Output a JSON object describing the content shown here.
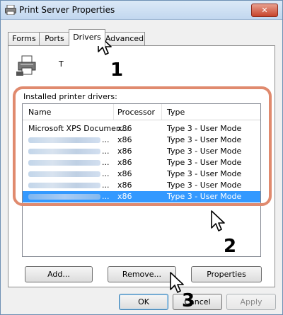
{
  "window": {
    "title": "Print Server Properties",
    "close_label": "✕"
  },
  "tabs": [
    {
      "label": "Forms"
    },
    {
      "label": "Ports"
    },
    {
      "label": "Drivers"
    },
    {
      "label": "Advanced"
    }
  ],
  "server": {
    "name": "T"
  },
  "drivers": {
    "group_label": "Installed printer drivers:",
    "columns": [
      "Name",
      "Processor",
      "Type"
    ],
    "rows": [
      {
        "name": "Microsoft XPS Documen...",
        "processor": "x86",
        "type": "Type 3 - User Mode",
        "selected": false
      },
      {
        "name": "...",
        "processor": "x86",
        "type": "Type 3 - User Mode",
        "selected": false
      },
      {
        "name": "...",
        "processor": "x86",
        "type": "Type 3 - User Mode",
        "selected": false
      },
      {
        "name": "...",
        "processor": "x86",
        "type": "Type 3 - User Mode",
        "selected": false
      },
      {
        "name": "...",
        "processor": "x86",
        "type": "Type 3 - User Mode",
        "selected": false
      },
      {
        "name": "...",
        "processor": "x86",
        "type": "Type 3 - User Mode",
        "selected": false
      },
      {
        "name": "...",
        "processor": "x86",
        "type": "Type 3 - User Mode",
        "selected": true
      }
    ]
  },
  "actions": {
    "add": "Add...",
    "remove": "Remove...",
    "properties": "Properties"
  },
  "footer": {
    "ok": "OK",
    "cancel": "Cancel",
    "apply": "Apply"
  },
  "steps": [
    "1",
    "2",
    "3"
  ],
  "colors": {
    "highlight": "#e08a6e",
    "selection": "#3399ff"
  }
}
